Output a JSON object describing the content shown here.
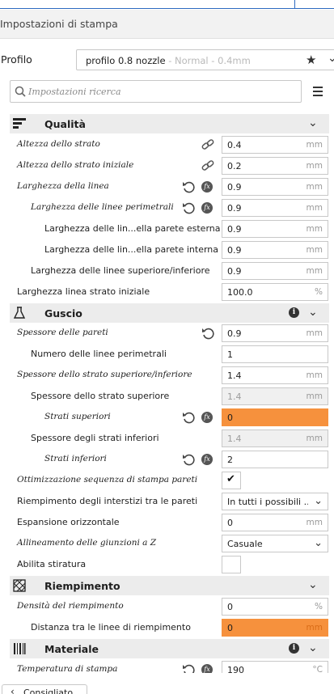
{
  "header": {
    "title": "Impostazioni di stampa"
  },
  "profile": {
    "label": "Profilo",
    "name": "profilo 0.8 nozzle",
    "sub": " - Normal - 0.4mm"
  },
  "search": {
    "placeholder": "Impostazioni ricerca"
  },
  "categories": {
    "quality": "Qualità",
    "shell": "Guscio",
    "infill": "Riempimento",
    "material": "Materiale"
  },
  "rows": {
    "layer_height": {
      "label": "Altezza dello strato",
      "value": "0.4",
      "unit": "mm"
    },
    "initial_layer_height": {
      "label": "Altezza dello strato iniziale",
      "value": "0.2",
      "unit": "mm"
    },
    "line_width": {
      "label": "Larghezza della linea",
      "value": "0.9",
      "unit": "mm"
    },
    "wall_line_width": {
      "label": "Larghezza delle linee perimetrali",
      "value": "0.9",
      "unit": "mm"
    },
    "outer_wall_width": {
      "label": "Larghezza delle lin...ella parete esterna",
      "value": "0.9",
      "unit": "mm"
    },
    "inner_wall_width": {
      "label": "Larghezza delle lin...ella parete interna",
      "value": "0.9",
      "unit": "mm"
    },
    "top_bottom_width": {
      "label": "Larghezza delle linee superiore/inferiore",
      "value": "0.9",
      "unit": "mm"
    },
    "initial_line_width": {
      "label": "Larghezza linea strato iniziale",
      "value": "100.0",
      "unit": "%"
    },
    "wall_thickness": {
      "label": "Spessore delle pareti",
      "value": "0.9",
      "unit": "mm"
    },
    "wall_count": {
      "label": "Numero delle linee perimetrali",
      "value": "1",
      "unit": ""
    },
    "top_bottom_thickness": {
      "label": "Spessore dello strato superiore/inferiore",
      "value": "1.4",
      "unit": "mm"
    },
    "top_thickness": {
      "label": "Spessore dello strato superiore",
      "value": "1.4",
      "unit": "mm"
    },
    "top_layers": {
      "label": "Strati superiori",
      "value": "0",
      "unit": ""
    },
    "bottom_thickness": {
      "label": "Spessore degli strati inferiori",
      "value": "1.4",
      "unit": "mm"
    },
    "bottom_layers": {
      "label": "Strati inferiori",
      "value": "2",
      "unit": ""
    },
    "optimize_wall_order": {
      "label": "Ottimizzazione sequenza di stampa pareti",
      "checked": true,
      "check_glyph": "✔"
    },
    "fill_gaps": {
      "label": "Riempimento degli interstizi tra le pareti",
      "value": "In tutti i possibili ..."
    },
    "horizontal_expansion": {
      "label": "Espansione orizzontale",
      "value": "0",
      "unit": "mm"
    },
    "z_seam": {
      "label": "Allineamento delle giunzioni a Z",
      "value": "Casuale"
    },
    "ironing": {
      "label": "Abilita stiratura",
      "checked": false
    },
    "infill_density": {
      "label": "Densità del riempimento",
      "value": "0",
      "unit": "%"
    },
    "infill_line_distance": {
      "label": "Distanza tra le linee di riempimento",
      "value": "0",
      "unit": "mm"
    },
    "print_temp": {
      "label": "Temperatura di stampa",
      "value": "190",
      "unit": "°C"
    }
  },
  "footer": {
    "button": "Consigliato"
  },
  "colors": {
    "warning": "#f6913d",
    "category_bg": "#ececec",
    "accent": "#2d6ac0"
  },
  "icons": {
    "quality": "quality-bars-icon",
    "shell": "shell-flask-icon",
    "infill": "infill-grid-icon",
    "material": "material-bars-icon",
    "reset": "reset-arrow-icon",
    "fx": "function-icon",
    "link": "link-chain-icon",
    "info": "info-icon"
  }
}
